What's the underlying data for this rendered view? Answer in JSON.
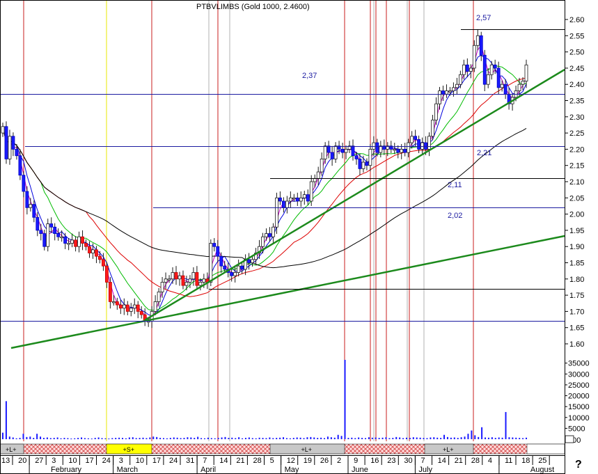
{
  "title": "PTBVLIMBS (Gold 1000, 2.4600)",
  "chart_data": {
    "type": "candlestick",
    "price_axis": {
      "ticks": [
        "2.60",
        "2.55",
        "2.50",
        "2.45",
        "2.40",
        "2.35",
        "2.30",
        "2.25",
        "2.20",
        "2.15",
        "2.10",
        "2.05",
        "2.00",
        "1.95",
        "1.90",
        "1.85",
        "1.80",
        "1.75",
        "1.70",
        "1.65",
        "1.60"
      ],
      "ylim": [
        1.57,
        2.62
      ]
    },
    "volume_axis": {
      "ticks": [
        "35000",
        "30000",
        "25000",
        "20000",
        "15000",
        "10000",
        "5000",
        "000"
      ],
      "ylim": [
        0,
        38000
      ]
    },
    "x_day_ticks": [
      "13",
      "20",
      "27",
      "3",
      "10",
      "17",
      "24",
      "3",
      "10",
      "17",
      "24",
      "31",
      "7",
      "14",
      "21",
      "28",
      "5",
      "12",
      "19",
      "26",
      "2",
      "9",
      "16",
      "23",
      "30",
      "7",
      "14",
      "21",
      "28",
      "4",
      "11",
      "18",
      "25"
    ],
    "months": [
      {
        "label": "February",
        "after_tick": 1
      },
      {
        "label": "March",
        "after_tick": 6
      },
      {
        "label": "April",
        "after_tick": 11
      },
      {
        "label": "May",
        "after_tick": 16
      },
      {
        "label": "June",
        "after_tick": 20
      },
      {
        "label": "July",
        "after_tick": 24
      },
      {
        "label": "August",
        "after_tick": 29
      }
    ],
    "horizontal_levels": [
      {
        "value": 2.57,
        "label": "2,57"
      },
      {
        "value": 2.37,
        "label": "2,37"
      },
      {
        "value": 2.21,
        "label": "2,21"
      },
      {
        "value": 2.11,
        "label": "2,11"
      },
      {
        "value": 2.02,
        "label": "2,02"
      },
      {
        "value": 1.77,
        "label": ""
      },
      {
        "value": 1.67,
        "label": ""
      }
    ],
    "signals": [
      {
        "label": "+L+",
        "color": "#c8c8c8"
      },
      {
        "label": "+S+",
        "color": "#ffff00"
      },
      {
        "label": "+L+",
        "color": "#c8c8c8"
      },
      {
        "label": "+L+",
        "color": "#c8c8c8"
      }
    ],
    "closes": [
      2.27,
      2.17,
      2.24,
      2.2,
      2.18,
      2.12,
      2.07,
      2.02,
      2.03,
      1.99,
      1.95,
      1.94,
      1.9,
      1.97,
      1.96,
      1.94,
      1.93,
      1.93,
      1.91,
      1.91,
      1.92,
      1.9,
      1.93,
      1.91,
      1.9,
      1.88,
      1.89,
      1.87,
      1.86,
      1.84,
      1.79,
      1.73,
      1.73,
      1.72,
      1.71,
      1.72,
      1.7,
      1.71,
      1.72,
      1.7,
      1.69,
      1.67,
      1.67,
      1.7,
      1.73,
      1.76,
      1.79,
      1.8,
      1.8,
      1.82,
      1.8,
      1.81,
      1.78,
      1.79,
      1.8,
      1.82,
      1.78,
      1.79,
      1.8,
      1.79,
      1.91,
      1.9,
      1.87,
      1.84,
      1.83,
      1.82,
      1.81,
      1.82,
      1.84,
      1.83,
      1.86,
      1.85,
      1.86,
      1.88,
      1.9,
      1.93,
      1.94,
      1.93,
      1.96,
      2.05,
      2.04,
      2.02,
      2.04,
      2.05,
      2.05,
      2.04,
      2.05,
      2.06,
      2.04,
      2.1,
      2.11,
      2.13,
      2.17,
      2.21,
      2.19,
      2.17,
      2.21,
      2.2,
      2.19,
      2.2,
      2.21,
      2.18,
      2.17,
      2.14,
      2.16,
      2.15,
      2.2,
      2.22,
      2.19,
      2.21,
      2.2,
      2.21,
      2.2,
      2.2,
      2.19,
      2.2,
      2.19,
      2.22,
      2.24,
      2.23,
      2.2,
      2.22,
      2.2,
      2.24,
      2.29,
      2.34,
      2.38,
      2.37,
      2.38,
      2.38,
      2.39,
      2.4,
      2.43,
      2.46,
      2.44,
      2.45,
      2.52,
      2.55,
      2.49,
      2.4,
      2.43,
      2.46,
      2.45,
      2.39,
      2.4,
      2.37,
      2.34,
      2.36,
      2.38,
      2.4,
      2.41,
      2.46
    ],
    "volumes": [
      3000,
      17500,
      1200,
      800,
      400,
      600,
      2500,
      1000,
      1200,
      600,
      2500,
      1200,
      600,
      800,
      500,
      600,
      800,
      400,
      600,
      500,
      300,
      400,
      600,
      800,
      500,
      400,
      300,
      600,
      800,
      500,
      400,
      300,
      500,
      600,
      700,
      600,
      400,
      800,
      900,
      500,
      600,
      700,
      500,
      800,
      1200,
      1000,
      600,
      500,
      400,
      600,
      800,
      700,
      500,
      600,
      900,
      800,
      600,
      1100,
      500,
      400,
      700,
      500,
      400,
      600,
      800,
      1000,
      600,
      700,
      500,
      900,
      400,
      600,
      800,
      500,
      400,
      700,
      600,
      500,
      800,
      500,
      600,
      700,
      900,
      500,
      400,
      600,
      800,
      700,
      500,
      900,
      1000,
      800,
      600,
      700,
      500,
      1200,
      900,
      700,
      2000,
      1500,
      36500,
      600,
      700,
      500,
      800,
      600,
      500,
      900,
      700,
      800,
      600,
      700,
      900,
      500,
      600,
      1000,
      800,
      500,
      700,
      600,
      900,
      800,
      700,
      600,
      500,
      800,
      900,
      700,
      600,
      2000,
      1000,
      700,
      800,
      600,
      900,
      1200,
      2500,
      4000,
      1800,
      1000,
      5500,
      800,
      700,
      900,
      600,
      800,
      700,
      12500,
      900,
      800,
      700,
      600,
      500,
      700
    ]
  }
}
